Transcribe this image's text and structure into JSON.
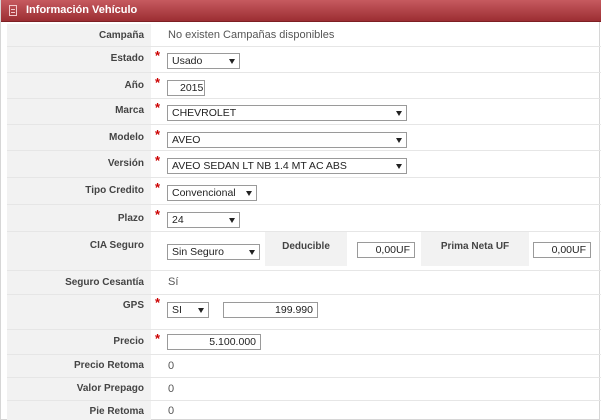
{
  "panel": {
    "title": "Información Vehículo"
  },
  "rows": {
    "campana": {
      "label": "Campaña",
      "value": "No existen Campañas disponibles"
    },
    "estado": {
      "label": "Estado",
      "value": "Usado"
    },
    "anio": {
      "label": "Año",
      "value": "2015"
    },
    "marca": {
      "label": "Marca",
      "value": "CHEVROLET"
    },
    "modelo": {
      "label": "Modelo",
      "value": "AVEO"
    },
    "version": {
      "label": "Versión",
      "value": "AVEO SEDAN LT NB 1.4 MT AC ABS"
    },
    "tipo_credito": {
      "label": "Tipo Credito",
      "value": "Convencional"
    },
    "plazo": {
      "label": "Plazo",
      "value": "24"
    },
    "cia_seguro": {
      "label": "CIA Seguro",
      "value": "Sin Seguro",
      "deducible_label": "Deducible",
      "deducible_value": "0,00UF",
      "prima_label": "Prima Neta UF",
      "prima_value": "0,00UF"
    },
    "seguro_cesantia": {
      "label": "Seguro Cesantía",
      "value": "Sí"
    },
    "gps": {
      "label": "GPS",
      "value": "SI",
      "amount": "199.990"
    },
    "precio": {
      "label": "Precio",
      "value": "5.100.000"
    },
    "precio_retoma": {
      "label": "Precio Retoma",
      "value": "0"
    },
    "valor_prepago": {
      "label": "Valor Prepago",
      "value": "0"
    },
    "pie_retoma": {
      "label": "Pie Retoma",
      "value": "0"
    }
  },
  "required_mark": "*",
  "colors": {
    "header": "#9c2e33",
    "required": "#cc0000",
    "label_bg": "#f2f2f2"
  }
}
